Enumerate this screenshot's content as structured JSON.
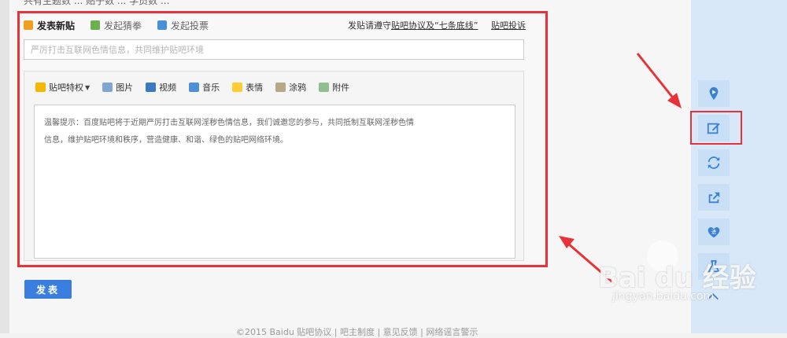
{
  "top_cut_text": "共有主题数 ... 贴子数 ... 学员数 ...",
  "tabs": [
    {
      "label": "发表新贴",
      "icon": "post-icon",
      "active": true
    },
    {
      "label": "发起猜拳",
      "icon": "guess-icon",
      "active": false
    },
    {
      "label": "发起投票",
      "icon": "vote-icon",
      "active": false
    }
  ],
  "notice": {
    "prefix": "发贴请遵守",
    "link": "贴吧协议及“七条底线”",
    "report": "贴吧投诉"
  },
  "title_input": {
    "placeholder": "严厉打击互联网色情信息，共同维护贴吧环境",
    "value": ""
  },
  "toolbar": {
    "privilege": "贴吧特权",
    "picture": "图片",
    "video": "视频",
    "music": "音乐",
    "emoji": "表情",
    "graffiti": "涂鸦",
    "attachment": "附件"
  },
  "content_hint": {
    "line1": "温馨提示：百度贴吧将于近期严厉打击互联网淫秽色情信息，我们诚邀您的参与，共同抵制互联网淫秽色情",
    "line2": "信息，维护贴吧环境和秩序，营造健康、和谐、绿色的贴吧网络环境。"
  },
  "submit_label": "发表",
  "footer": "©2015 Baidu 贴吧协议 | 吧主制度 | 意见反馈 | 网络谣言警示",
  "right_tools": [
    {
      "icon": "location-icon"
    },
    {
      "icon": "edit-icon"
    },
    {
      "icon": "refresh-icon"
    },
    {
      "icon": "share-icon"
    },
    {
      "icon": "heart-icon",
      "badge": "进"
    },
    {
      "icon": "flask-icon"
    }
  ],
  "watermark": {
    "main": "Bai du 经验",
    "sub": "jingyan.baidu.com"
  },
  "colors": {
    "accent": "#3a7fe0",
    "highlight": "#e8323a",
    "panel": "#d8e8f8"
  }
}
